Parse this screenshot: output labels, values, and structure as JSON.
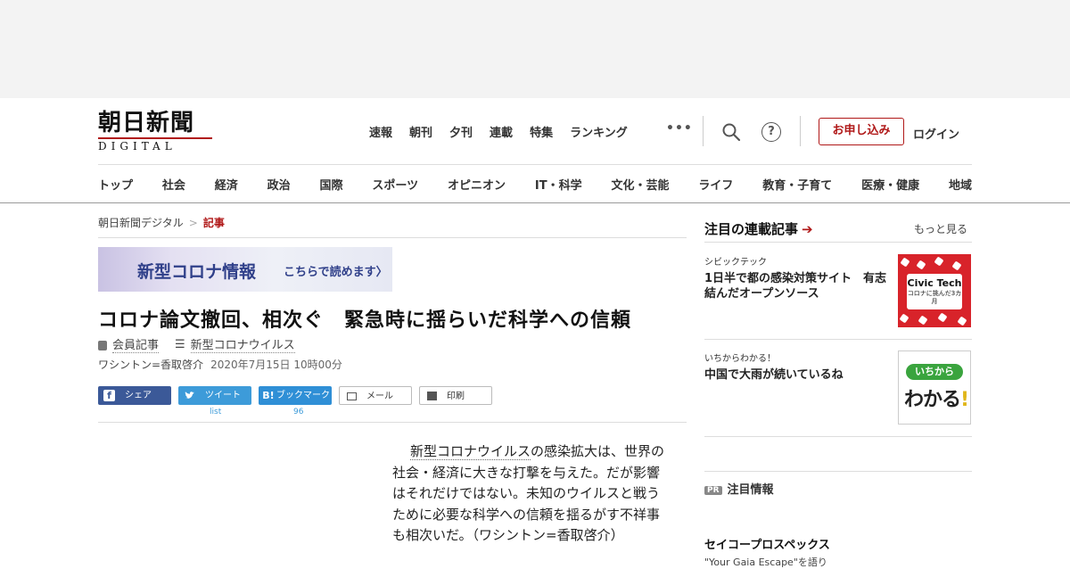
{
  "header": {
    "logo_kanji": "朝日新聞",
    "logo_sub": "DIGITAL",
    "topnav": [
      "速報",
      "朝刊",
      "夕刊",
      "連載",
      "特集",
      "ランキング"
    ],
    "more": "•••",
    "help": "?",
    "subscribe": "お申し込み",
    "login": "ログイン"
  },
  "categories": [
    "トップ",
    "社会",
    "経済",
    "政治",
    "国際",
    "スポーツ",
    "オピニオン",
    "IT・科学",
    "文化・芸能",
    "ライフ",
    "教育・子育て",
    "医療・健康",
    "地域"
  ],
  "breadcrumb": {
    "home": "朝日新聞デジタル",
    "sep": ">",
    "current": "記事"
  },
  "banner": {
    "title": "新型コロナ情報",
    "cta": "こちらで読めます〉"
  },
  "article": {
    "headline": "コロナ論文撤回、相次ぐ　緊急時に揺らいだ科学への信頼",
    "member": "会員記事",
    "topic": "新型コロナウイルス",
    "author": "ワシントン=香取啓介",
    "date": "2020年7月15日 10時00分",
    "body_link": "新型コロナウイルス",
    "body_rest": "の感染拡大は、世界の社会・経済に大きな打撃を与えた。だが影響はそれだけではない。未知のウイルスと戦うために必要な科学への信頼を揺るがす不祥事も相次いだ。（ワシントン=香取啓介）"
  },
  "share": {
    "facebook": "シェア",
    "facebook_icon": "f",
    "twitter": "ツイート",
    "twitter_icon": "bird-icon",
    "hatena": "ブックマーク",
    "hatena_icon": "B!",
    "mail": "メール",
    "print": "印刷",
    "twitter_count": "list",
    "hatena_count": "96"
  },
  "sidebar": {
    "heading": "注目の連載記事",
    "arrow": "➔",
    "more": "もっと見る",
    "items": [
      {
        "kicker": "シビックテック",
        "title": "1日半で都の感染対策サイト　有志結んだオープンソース",
        "thumb_title": "Civic Tech",
        "thumb_sub": "コロナに挑んだ3カ月"
      },
      {
        "kicker": "いちからわかる！",
        "title": "中国で大雨が続いているね",
        "thumb_pill": "いちから",
        "thumb_big": "わかる",
        "thumb_ex": "!"
      }
    ],
    "pr_badge": "PR",
    "pr_label": "注目情報",
    "promo_title": "セイコープロスペックス",
    "promo_sub": "\"Your Gaia Escape\"を語り"
  },
  "colors": {
    "brand_red": "#b01818",
    "facebook": "#3b5998",
    "twitter": "#3d9bd9",
    "hatena": "#2f8fd6",
    "banner_text": "#30408a",
    "civic_red": "#d8232a",
    "ichi_green": "#3aa43e"
  }
}
